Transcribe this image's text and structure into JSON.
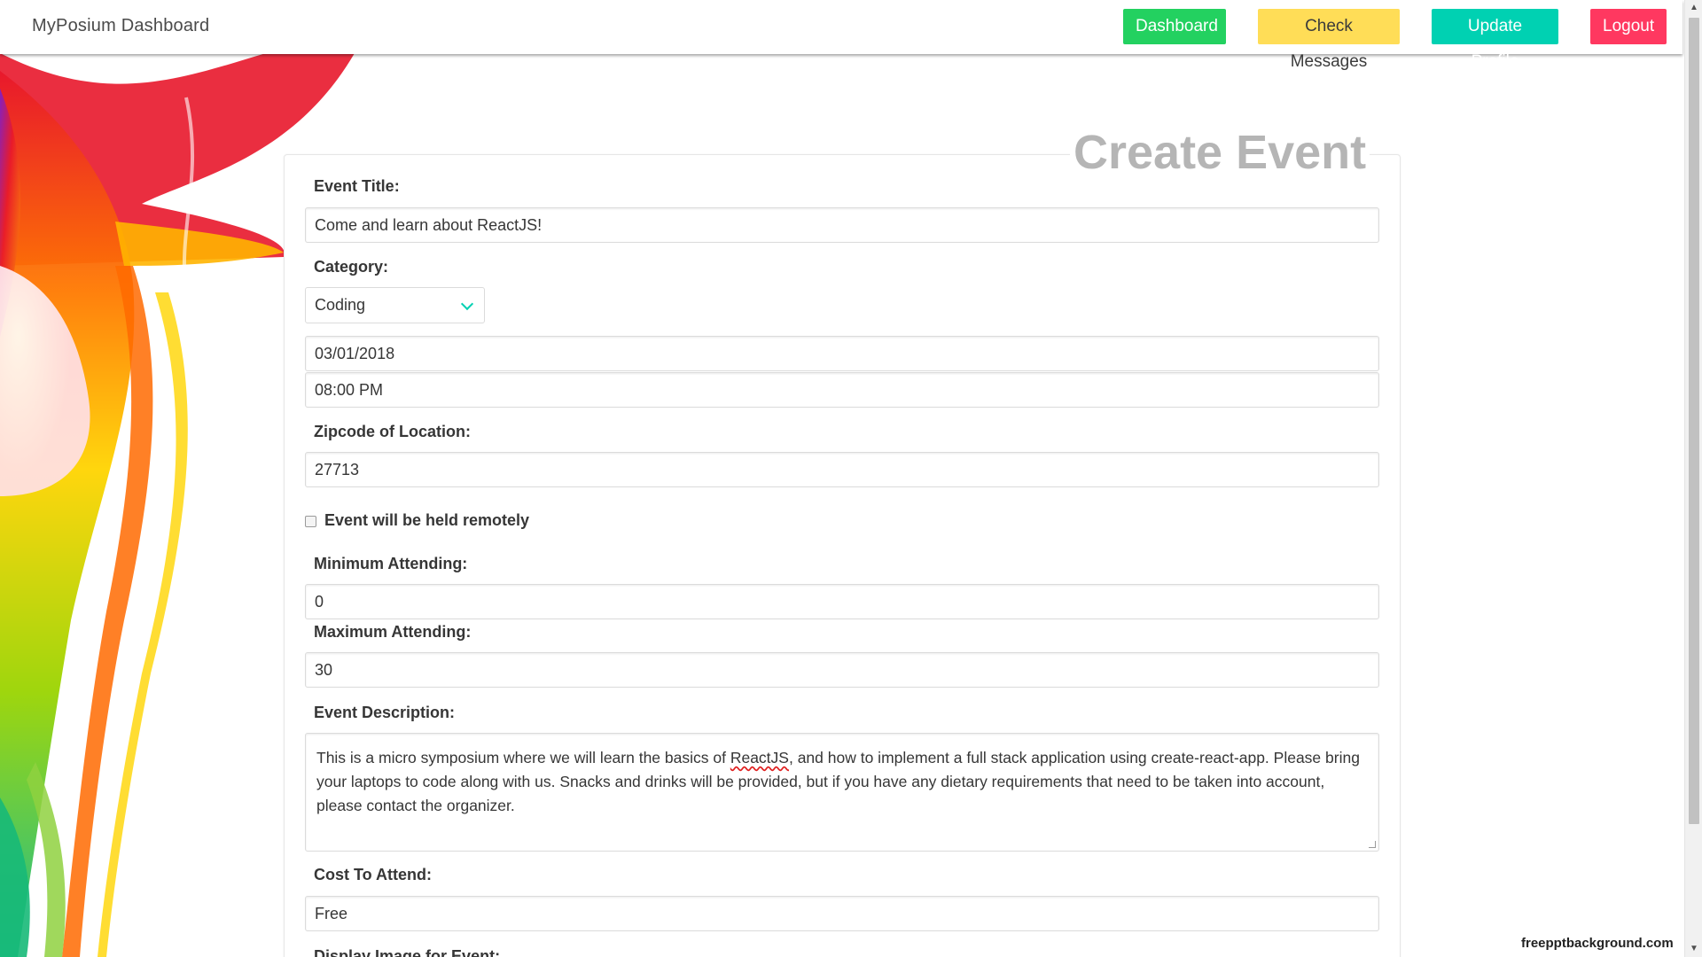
{
  "navbar": {
    "brand": "MyPosium Dashboard",
    "buttons": {
      "dashboard": "Dashboard",
      "messages": "Check Messages",
      "profile": "Update Profile",
      "logout": "Logout"
    }
  },
  "form": {
    "title": "Create Event",
    "event_title": {
      "label": "Event Title:",
      "value": "Come and learn about ReactJS!"
    },
    "category": {
      "label": "Category:",
      "value": "Coding"
    },
    "date": {
      "value": "03/01/2018"
    },
    "time": {
      "value": "08:00 PM"
    },
    "zipcode": {
      "label": "Zipcode of Location:",
      "value": "27713"
    },
    "remote": {
      "label": "Event will be held remotely",
      "checked": false
    },
    "min_attending": {
      "label": "Minimum Attending:",
      "value": "0"
    },
    "max_attending": {
      "label": "Maximum Attending:",
      "value": "30"
    },
    "description": {
      "label": "Event Description:",
      "before": "This is a micro symposium where we will learn the basics of ",
      "spell_word": "ReactJS",
      "after": ", and how to implement a full stack application using create-react-app.  Please bring your laptops to code along with us.  Snacks and drinks will be provided, but if you have any dietary requirements that need to be taken into account, please contact the organizer."
    },
    "cost": {
      "label": "Cost To Attend:",
      "value": "Free"
    },
    "display_image": {
      "label": "Display Image for Event:"
    }
  },
  "watermark": "freepptbackground.com",
  "colors": {
    "dashboard": "#23d160",
    "messages": "#ffdd57",
    "profile": "#00d1b2",
    "logout": "#ff3860",
    "title": "#b5b5b5"
  }
}
